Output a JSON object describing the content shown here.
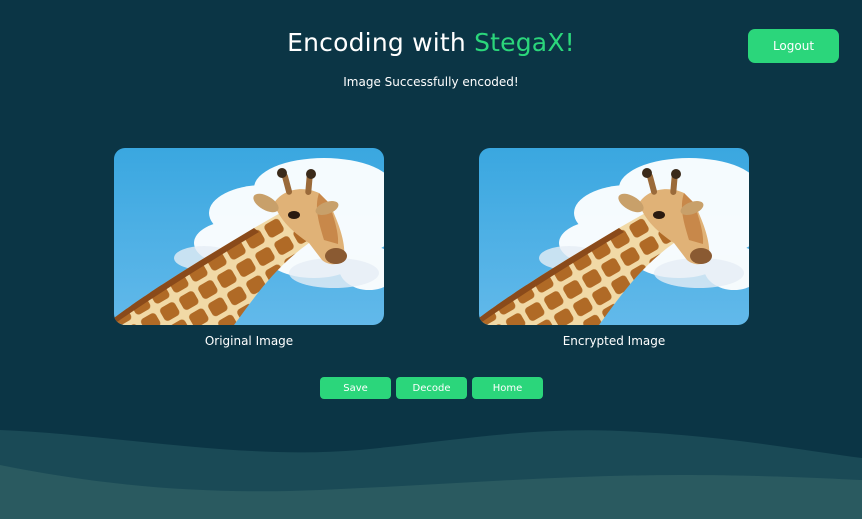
{
  "header": {
    "title_prefix": "Encoding with ",
    "title_brand": "StegaX!",
    "status": "Image Successfully encoded!",
    "logout_label": "Logout"
  },
  "images": [
    {
      "caption": "Original Image",
      "icon": "giraffe-photo"
    },
    {
      "caption": "Encrypted Image",
      "icon": "giraffe-photo"
    }
  ],
  "actions": {
    "save_label": "Save",
    "decode_label": "Decode",
    "home_label": "Home"
  },
  "colors": {
    "background": "#0b3545",
    "accent": "#2bd67b",
    "wave_back": "#1a4a56",
    "wave_front": "#2a5a60"
  }
}
